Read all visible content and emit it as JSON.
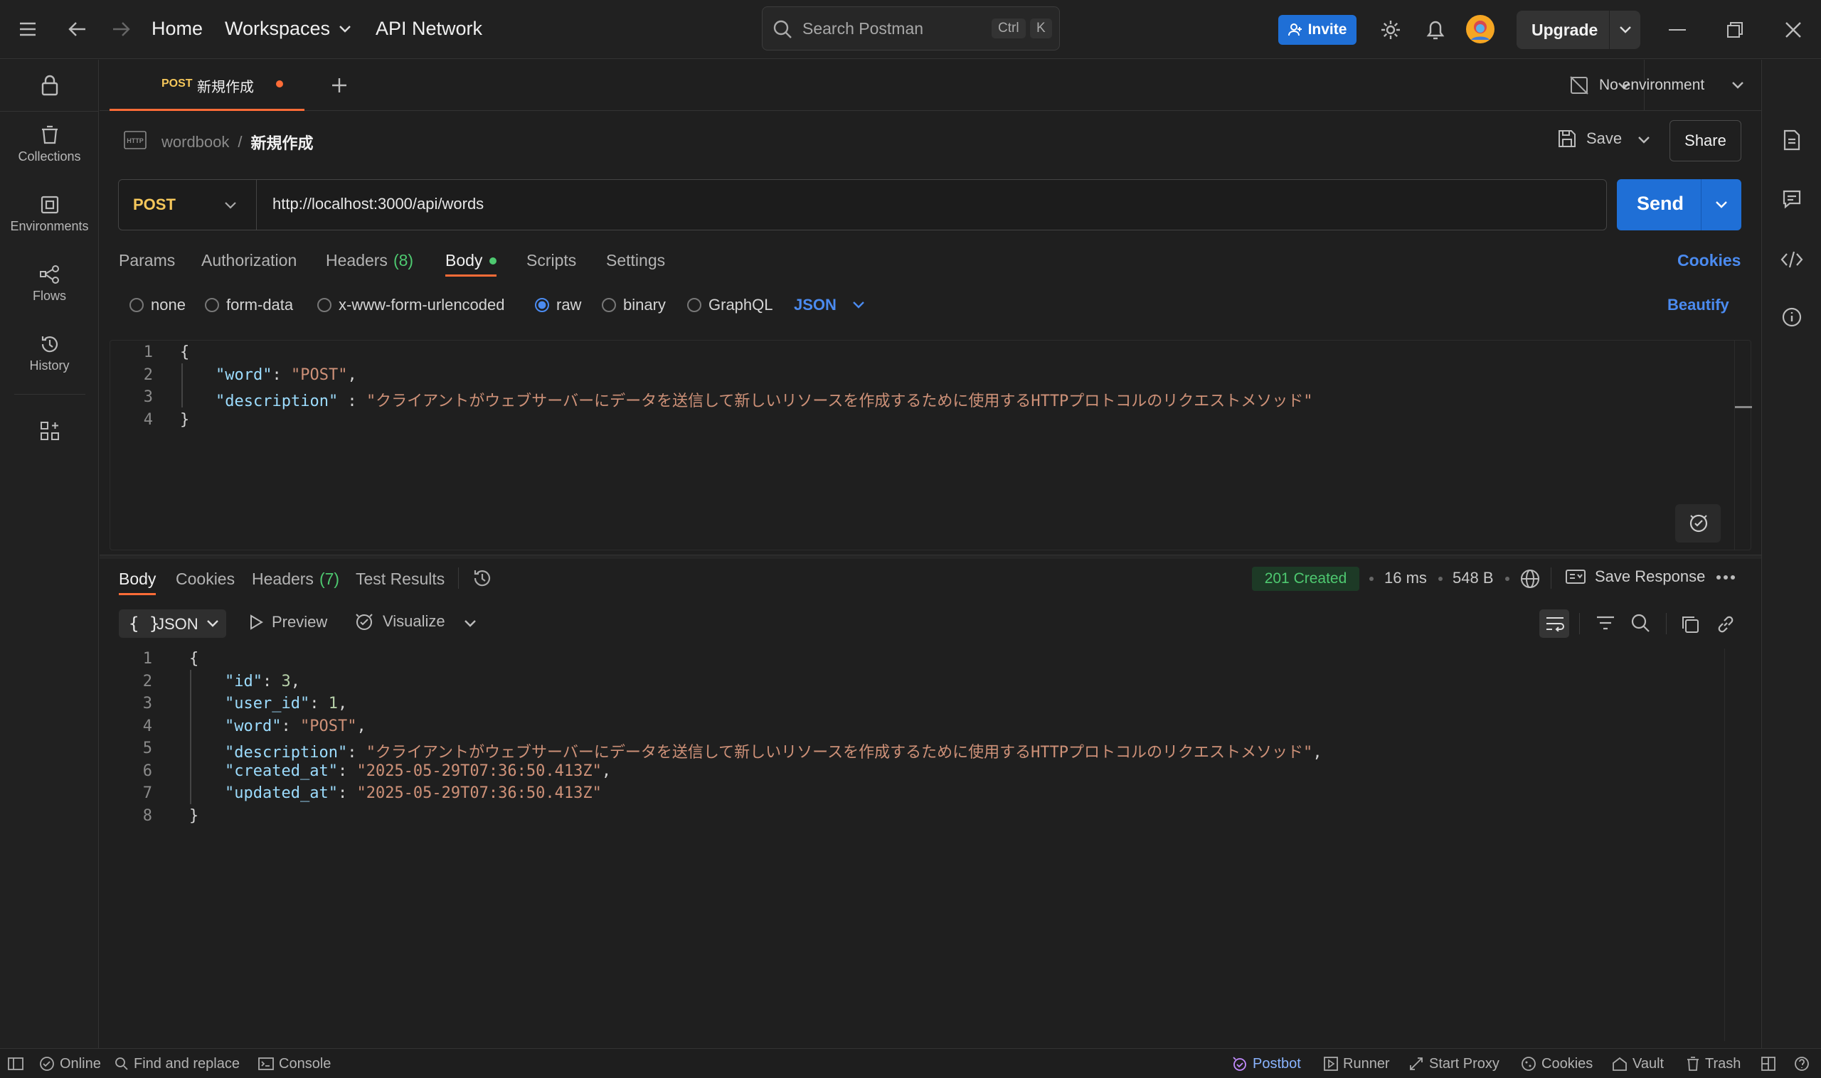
{
  "topbar": {
    "home": "Home",
    "workspaces": "Workspaces",
    "api_network": "API Network",
    "search_placeholder": "Search Postman",
    "shortcut_ctrl": "Ctrl",
    "shortcut_k": "K",
    "invite": "Invite",
    "upgrade": "Upgrade"
  },
  "sidebar": {
    "items": [
      {
        "label": "Collections"
      },
      {
        "label": "Environments"
      },
      {
        "label": "Flows"
      },
      {
        "label": "History"
      }
    ]
  },
  "tabstrip": {
    "tab_method": "POST",
    "tab_title": "新規作成",
    "environment": "No environment"
  },
  "request": {
    "breadcrumb_collection": "wordbook",
    "breadcrumb_sep": "/",
    "breadcrumb_name": "新規作成",
    "save": "Save",
    "share": "Share",
    "method": "POST",
    "url": "http://localhost:3000/api/words",
    "send": "Send",
    "tabs": {
      "params": "Params",
      "authorization": "Authorization",
      "headers": "Headers",
      "headers_count": "(8)",
      "body": "Body",
      "scripts": "Scripts",
      "settings": "Settings",
      "cookies": "Cookies"
    },
    "body_types": {
      "none": "none",
      "form_data": "form-data",
      "urlencoded": "x-www-form-urlencoded",
      "raw": "raw",
      "binary": "binary",
      "graphql": "GraphQL",
      "format": "JSON",
      "beautify": "Beautify",
      "selected": "raw"
    },
    "code": {
      "l1": "{",
      "l2_key": "\"word\"",
      "l2_sep": ": ",
      "l2_val": "\"POST\"",
      "l2_end": ",",
      "l3_key": "\"description\"",
      "l3_sep": " : ",
      "l3_val": "\"クライアントがウェブサーバーにデータを送信して新しいリソースを作成するために使用するHTTPプロトコルのリクエストメソッド\"",
      "l4": "}"
    }
  },
  "response": {
    "tabs": {
      "body": "Body",
      "cookies": "Cookies",
      "headers": "Headers",
      "headers_count": "(7)",
      "test_results": "Test Results"
    },
    "status": "201 Created",
    "time": "16 ms",
    "size": "548 B",
    "save_response": "Save Response",
    "format": "JSON",
    "preview": "Preview",
    "visualize": "Visualize",
    "code": {
      "open": "{",
      "id_key": "\"id\"",
      "id_val": "3",
      "user_key": "\"user_id\"",
      "user_val": "1",
      "word_key": "\"word\"",
      "word_val": "\"POST\"",
      "desc_key": "\"description\"",
      "desc_val": "\"クライアントがウェブサーバーにデータを送信して新しいリソースを作成するために使用するHTTPプロトコルのリクエストメソッド\"",
      "created_key": "\"created_at\"",
      "created_val": "\"2025-05-29T07:36:50.413Z\"",
      "updated_key": "\"updated_at\"",
      "updated_val": "\"2025-05-29T07:36:50.413Z\"",
      "close": "}"
    }
  },
  "footer": {
    "online": "Online",
    "find_replace": "Find and replace",
    "console": "Console",
    "postbot": "Postbot",
    "runner": "Runner",
    "start_proxy": "Start Proxy",
    "cookies": "Cookies",
    "vault": "Vault",
    "trash": "Trash"
  },
  "colors": {
    "accent_blue": "#1f6fd6",
    "postman_orange": "#ff6c37",
    "status_green": "#4ec970",
    "method_yellow": "#f5c75b"
  }
}
